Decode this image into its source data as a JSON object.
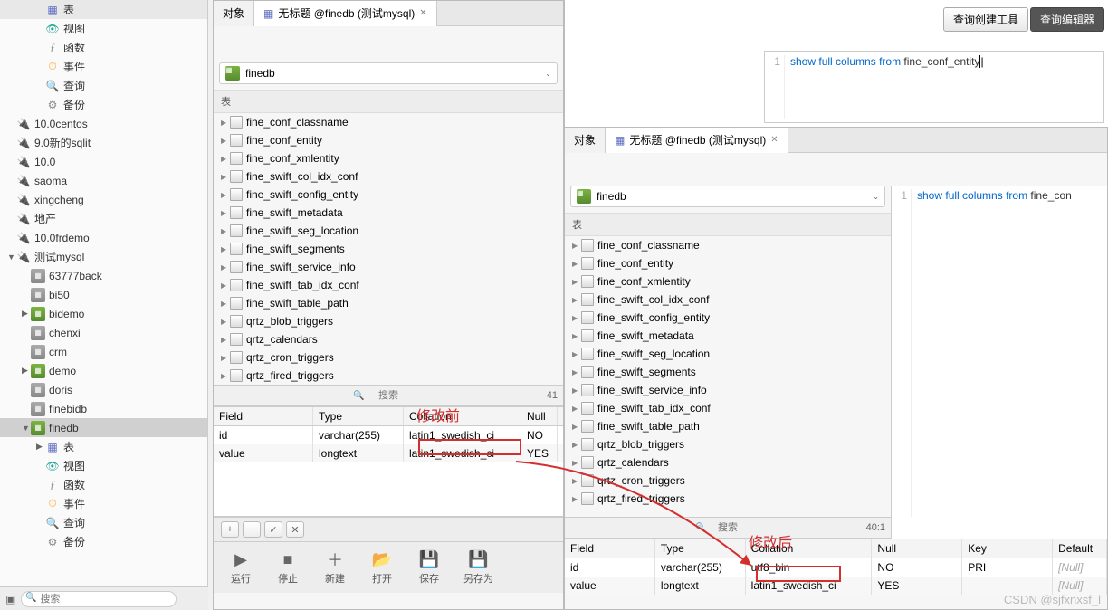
{
  "sidebar": {
    "search_placeholder": "搜索",
    "items": [
      {
        "label": "表",
        "icon": "table",
        "indent": 2,
        "tri": ""
      },
      {
        "label": "视图",
        "icon": "view",
        "indent": 2,
        "tri": ""
      },
      {
        "label": "函数",
        "icon": "func",
        "indent": 2,
        "tri": ""
      },
      {
        "label": "事件",
        "icon": "event",
        "indent": 2,
        "tri": ""
      },
      {
        "label": "查询",
        "icon": "query",
        "indent": 2,
        "tri": ""
      },
      {
        "label": "备份",
        "icon": "backup",
        "indent": 2,
        "tri": ""
      },
      {
        "label": "10.0centos",
        "icon": "conn",
        "indent": 0,
        "tri": ""
      },
      {
        "label": "9.0新的sqlit",
        "icon": "conn",
        "indent": 0,
        "tri": ""
      },
      {
        "label": "10.0",
        "icon": "conn",
        "indent": 0,
        "tri": ""
      },
      {
        "label": "saoma",
        "icon": "conn",
        "indent": 0,
        "tri": ""
      },
      {
        "label": "xingcheng",
        "icon": "conn",
        "indent": 0,
        "tri": ""
      },
      {
        "label": "地产",
        "icon": "conn",
        "indent": 0,
        "tri": ""
      },
      {
        "label": "10.0frdemo",
        "icon": "conn",
        "indent": 0,
        "tri": ""
      },
      {
        "label": "测试mysql",
        "icon": "conn",
        "indent": 0,
        "tri": "▼"
      },
      {
        "label": "63777back",
        "icon": "db-off",
        "indent": 1,
        "tri": ""
      },
      {
        "label": "bi50",
        "icon": "db-off",
        "indent": 1,
        "tri": ""
      },
      {
        "label": "bidemo",
        "icon": "db",
        "indent": 1,
        "tri": "▶"
      },
      {
        "label": "chenxi",
        "icon": "db-off",
        "indent": 1,
        "tri": ""
      },
      {
        "label": "crm",
        "icon": "db-off",
        "indent": 1,
        "tri": ""
      },
      {
        "label": "demo",
        "icon": "db",
        "indent": 1,
        "tri": "▶"
      },
      {
        "label": "doris",
        "icon": "db-off",
        "indent": 1,
        "tri": ""
      },
      {
        "label": "finebidb",
        "icon": "db-off",
        "indent": 1,
        "tri": ""
      },
      {
        "label": "finedb",
        "icon": "db",
        "indent": 1,
        "tri": "▼",
        "selected": true
      },
      {
        "label": "表",
        "icon": "table",
        "indent": 2,
        "tri": "▶"
      },
      {
        "label": "视图",
        "icon": "view",
        "indent": 2,
        "tri": ""
      },
      {
        "label": "函数",
        "icon": "func",
        "indent": 2,
        "tri": ""
      },
      {
        "label": "事件",
        "icon": "event",
        "indent": 2,
        "tri": ""
      },
      {
        "label": "查询",
        "icon": "query",
        "indent": 2,
        "tri": ""
      },
      {
        "label": "备份",
        "icon": "backup",
        "indent": 2,
        "tri": ""
      }
    ]
  },
  "panel_a": {
    "tabs": [
      {
        "label": "对象",
        "active": false
      },
      {
        "label": "无标题 @finedb (测试mysql)",
        "active": true,
        "closable": true
      }
    ],
    "db_selected": "finedb",
    "section_label": "表",
    "tables": [
      "fine_conf_classname",
      "fine_conf_entity",
      "fine_conf_xmlentity",
      "fine_swift_col_idx_conf",
      "fine_swift_config_entity",
      "fine_swift_metadata",
      "fine_swift_seg_location",
      "fine_swift_segments",
      "fine_swift_service_info",
      "fine_swift_tab_idx_conf",
      "fine_swift_table_path",
      "qrtz_blob_triggers",
      "qrtz_calendars",
      "qrtz_cron_triggers",
      "qrtz_fired_triggers"
    ],
    "search_placeholder": "搜索",
    "search_count": "41",
    "annotation_before": "修改前",
    "columns_header": [
      "Field",
      "Type",
      "Collation",
      "Null"
    ],
    "columns_rows": [
      {
        "Field": "id",
        "Type": "varchar(255)",
        "Collation": "latin1_swedish_ci",
        "Null": "NO"
      },
      {
        "Field": "value",
        "Type": "longtext",
        "Collation": "latin1_swedish_ci",
        "Null": "YES"
      }
    ],
    "actions": [
      {
        "label": "运行",
        "icon": "▶"
      },
      {
        "label": "停止",
        "icon": "■"
      },
      {
        "label": "新建",
        "icon": "＋"
      },
      {
        "label": "打开",
        "icon": "📂"
      },
      {
        "label": "保存",
        "icon": "💾"
      },
      {
        "label": "另存为",
        "icon": "💾"
      }
    ]
  },
  "top_right": {
    "toolbar": {
      "btn1": "查询创建工具",
      "btn2": "查询编辑器"
    },
    "sql": {
      "line": "1",
      "kw1": "show",
      "kw2": "full",
      "kw3": "columns",
      "kw4": "from",
      "ident": "fine_conf_entity"
    }
  },
  "panel_b": {
    "tabs": [
      {
        "label": "对象",
        "active": false
      },
      {
        "label": "无标题 @finedb (测试mysql)",
        "active": true,
        "closable": true
      }
    ],
    "sql": {
      "line": "1",
      "kw1": "show",
      "kw2": "full",
      "kw3": "columns",
      "kw4": "from",
      "ident": "fine_con"
    },
    "db_selected": "finedb",
    "section_label": "表",
    "tables": [
      "fine_conf_classname",
      "fine_conf_entity",
      "fine_conf_xmlentity",
      "fine_swift_col_idx_conf",
      "fine_swift_config_entity",
      "fine_swift_metadata",
      "fine_swift_seg_location",
      "fine_swift_segments",
      "fine_swift_service_info",
      "fine_swift_tab_idx_conf",
      "fine_swift_table_path",
      "qrtz_blob_triggers",
      "qrtz_calendars",
      "qrtz_cron_triggers",
      "qrtz_fired_triggers"
    ],
    "search_placeholder": "搜索",
    "search_count": "40:1",
    "annotation_after": "修改后",
    "columns_header": [
      "Field",
      "Type",
      "Collation",
      "Null",
      "Key",
      "Default"
    ],
    "columns_rows": [
      {
        "Field": "id",
        "Type": "varchar(255)",
        "Collation": "utf8_bin",
        "Null": "NO",
        "Key": "PRI",
        "Default": "[Null]"
      },
      {
        "Field": "value",
        "Type": "longtext",
        "Collation": "latin1_swedish_ci",
        "Null": "YES",
        "Key": "",
        "Default": "[Null]"
      }
    ]
  },
  "watermark": "CSDN @sjfxnxsf_l"
}
